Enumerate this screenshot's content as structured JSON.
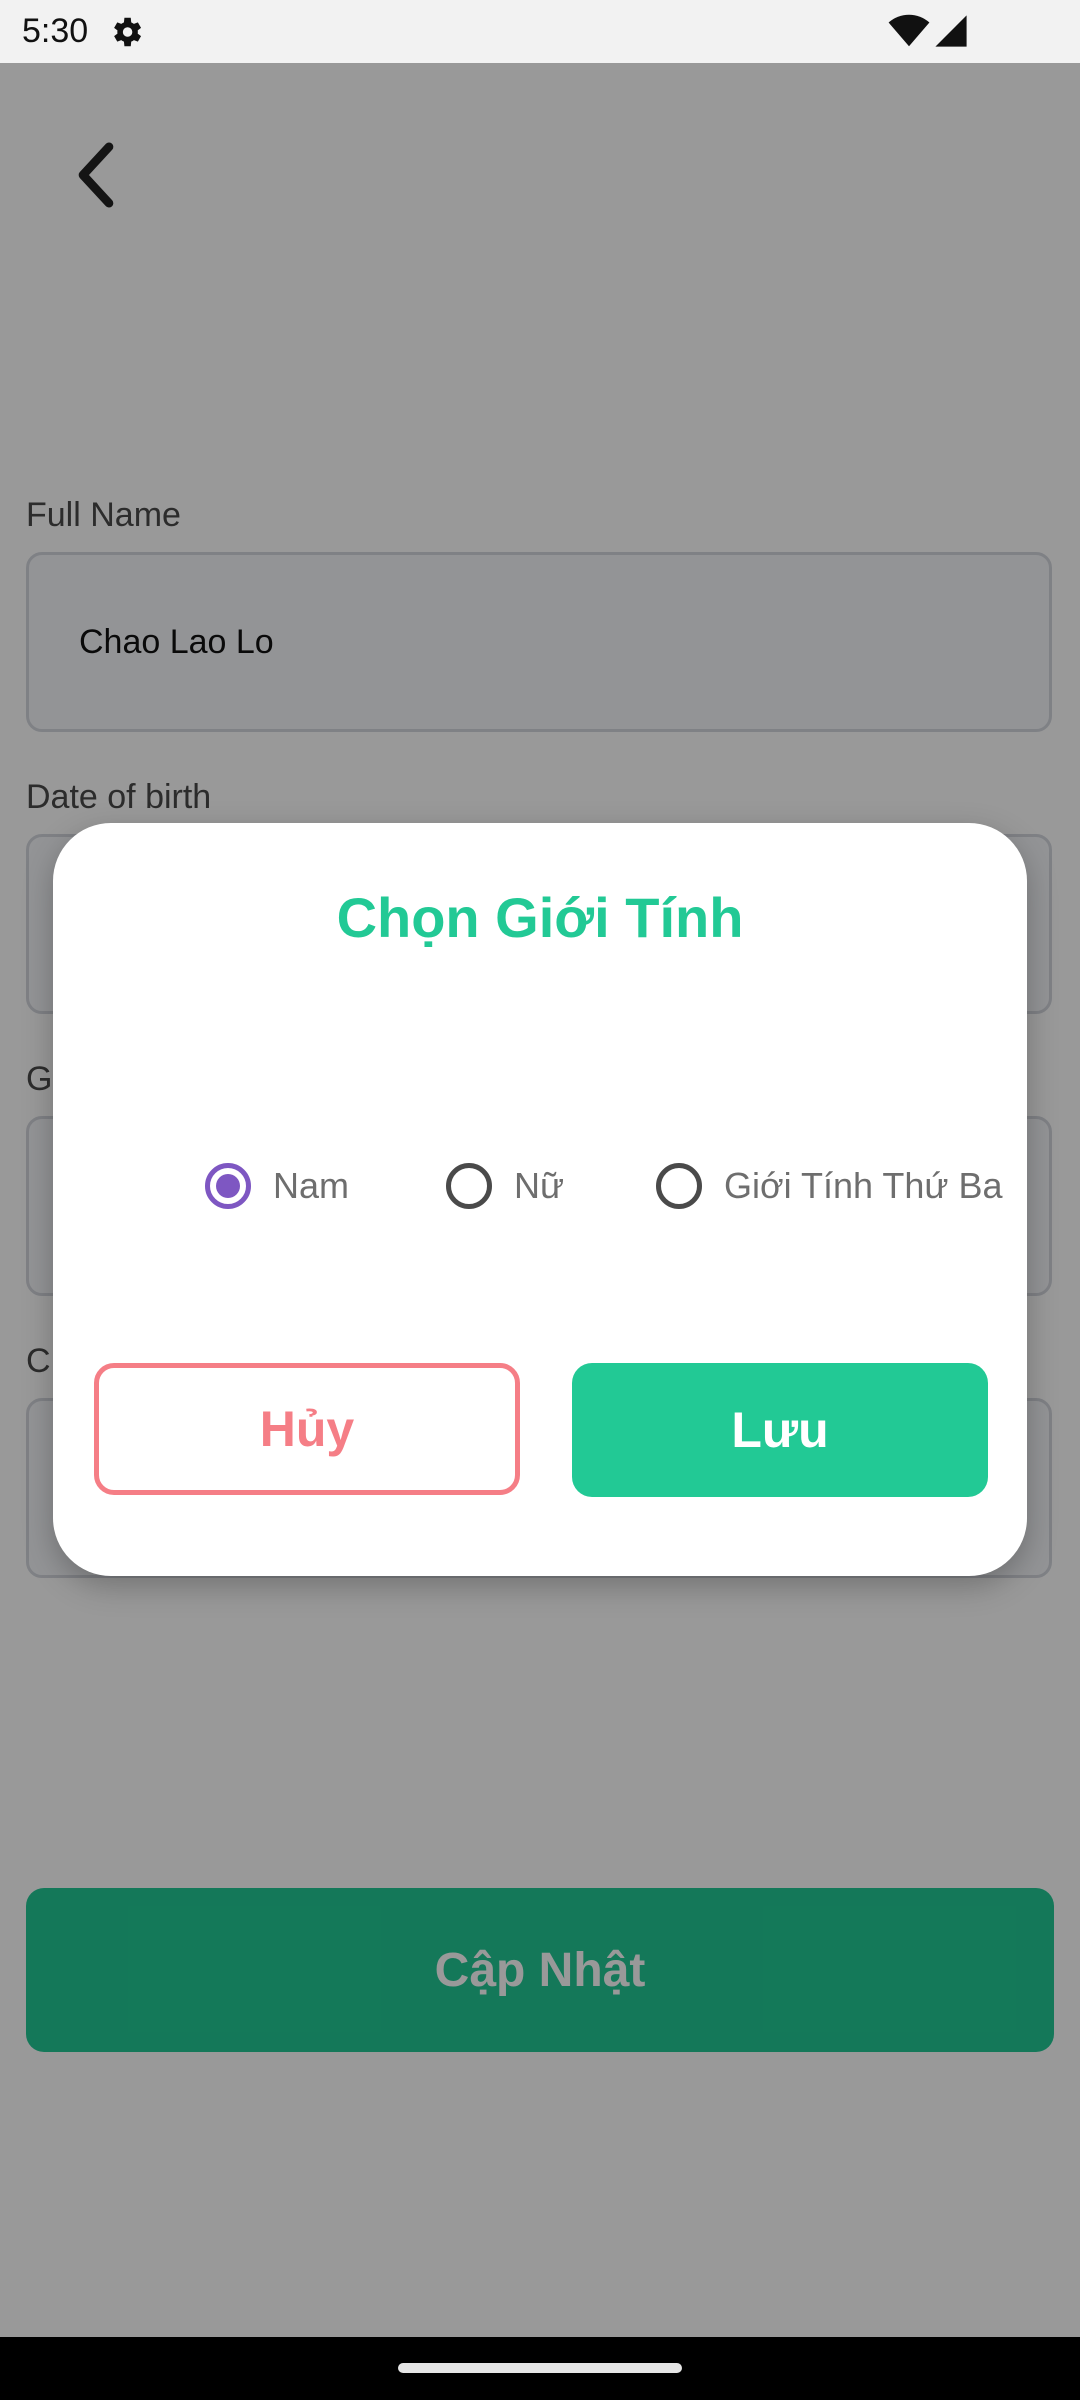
{
  "status_bar": {
    "time": "5:30",
    "icons": [
      "gear-icon",
      "wifi-icon",
      "signal-icon"
    ]
  },
  "page": {
    "fields": [
      {
        "label": "Full Name",
        "value": "Chao Lao Lo"
      },
      {
        "label": "Date of birth",
        "value": ""
      },
      {
        "label": "G",
        "value": ""
      },
      {
        "label": "C",
        "value": ""
      }
    ],
    "update_button_label": "Cập Nhật"
  },
  "dialog": {
    "title": "Chọn Giới Tính",
    "options": [
      {
        "label": "Nam",
        "selected": true
      },
      {
        "label": "Nữ",
        "selected": false
      },
      {
        "label": "Giới Tính Thứ Ba",
        "selected": false
      }
    ],
    "cancel_label": "Hủy",
    "save_label": "Lưu"
  },
  "colors": {
    "accent": "#22c995",
    "radio_selected": "#7e57c2",
    "cancel": "#f57e86"
  }
}
